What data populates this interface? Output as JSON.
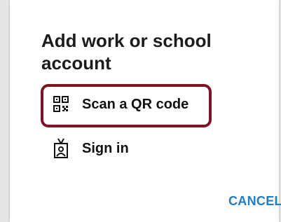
{
  "dialog": {
    "title": "Add work or school account",
    "options": [
      {
        "label": "Scan a QR code",
        "icon": "qr-code-icon",
        "highlighted": true
      },
      {
        "label": "Sign in",
        "icon": "id-badge-icon",
        "highlighted": false
      }
    ],
    "cancel_label": "CANCEL"
  },
  "colors": {
    "highlight_border": "#7d1525",
    "cancel_text": "#1e7fc4",
    "title_text": "#1c1c1c"
  }
}
